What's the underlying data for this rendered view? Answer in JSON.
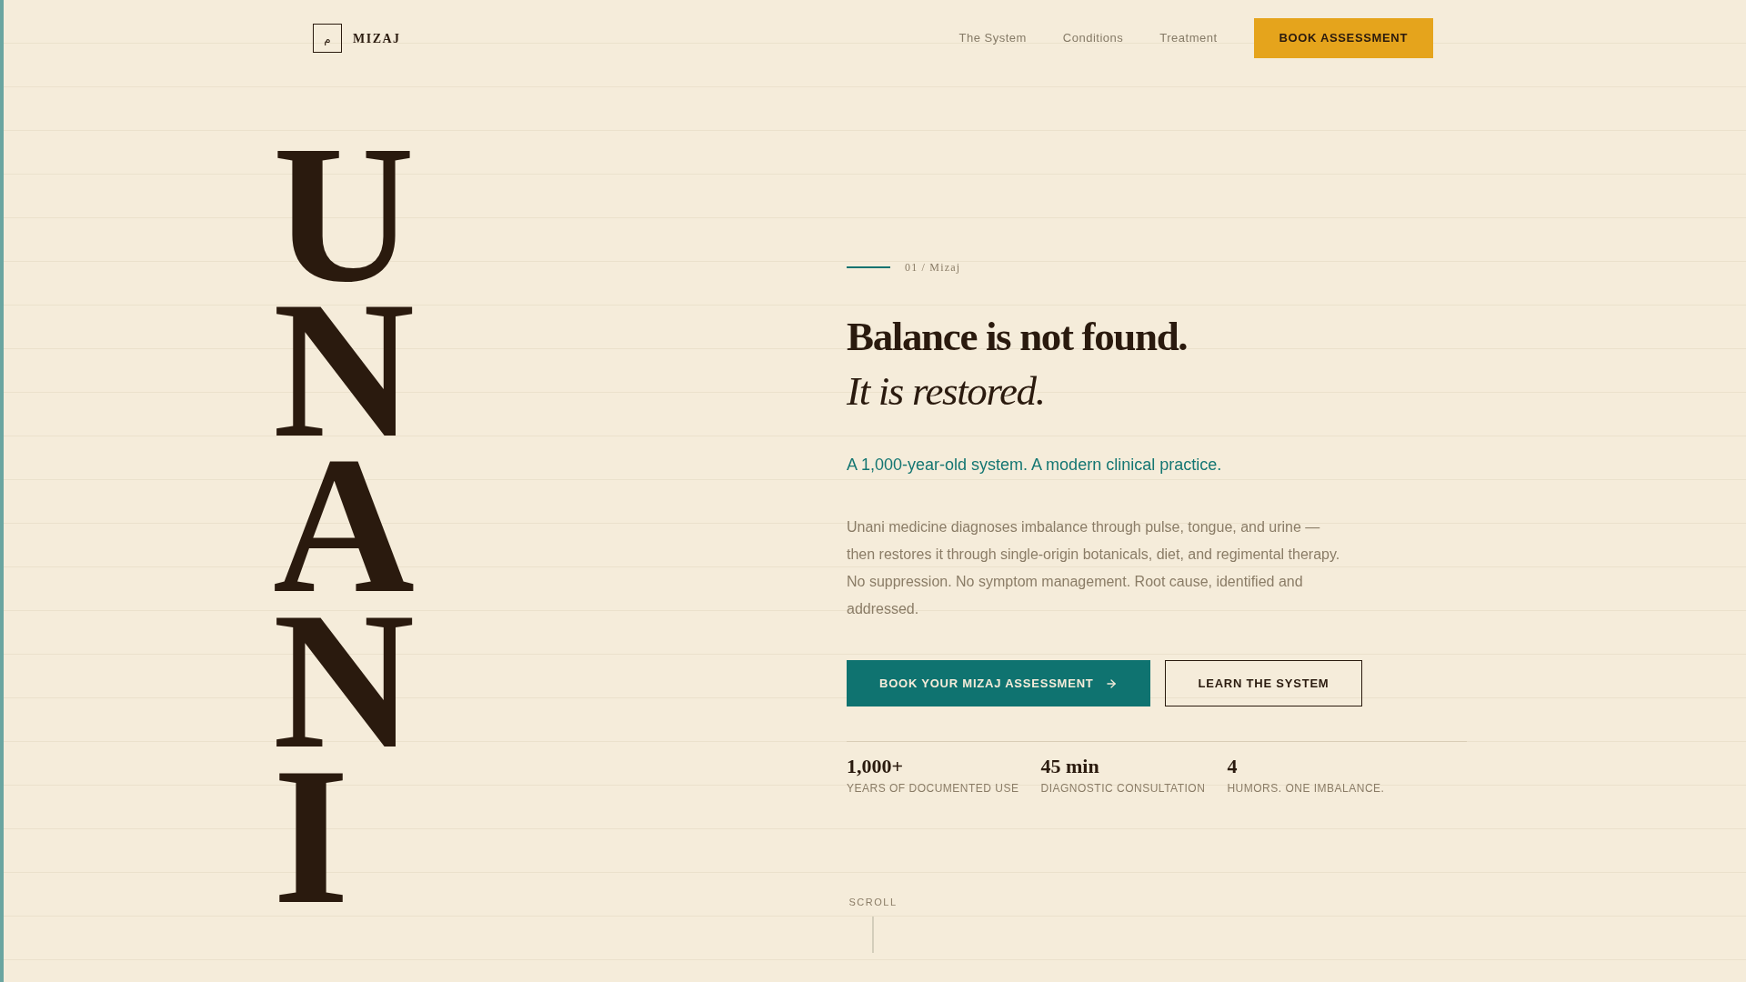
{
  "header": {
    "logo": {
      "mark": "م",
      "name": "MIZAJ"
    },
    "nav": [
      "The System",
      "Conditions",
      "Treatment"
    ],
    "cta": "BOOK ASSESSMENT"
  },
  "hero": {
    "vertical_word": "UNANI",
    "eyebrow": "01 / Mizaj",
    "headline": "Balance is not found.",
    "headline_italic": "It is restored.",
    "subtitle": "A 1,000-year-old system. A modern clinical practice.",
    "body": "Unani medicine diagnoses imbalance through pulse, tongue, and urine — then restores it through single-origin botanicals, diet, and regimental therapy. No suppression. No symptom management. Root cause, identified and addressed.",
    "buttons": [
      {
        "label": "BOOK YOUR MIZAJ ASSESSMENT",
        "kind": "primary"
      },
      {
        "label": "LEARN THE SYSTEM",
        "kind": "outline"
      }
    ],
    "stats": [
      {
        "value": "1,000+",
        "label": "YEARS OF DOCUMENTED USE"
      },
      {
        "value": "45 min",
        "label": "DIAGNOSTIC CONSULTATION"
      },
      {
        "value": "4",
        "label": "HUMORS. ONE IMBALANCE."
      }
    ]
  },
  "scroll_hint": "SCROLL"
}
